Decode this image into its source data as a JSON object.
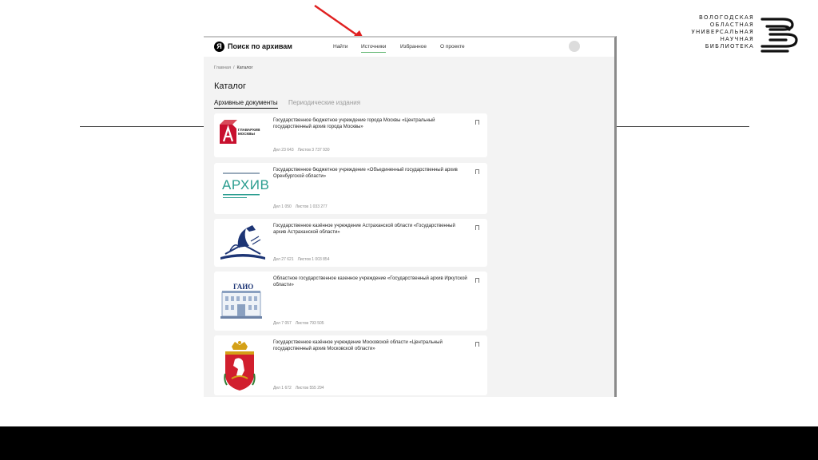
{
  "library": {
    "lines": [
      "ВОЛОГОДСКАЯ",
      "ОБЛАСТНАЯ",
      "УНИВЕРСАЛЬНАЯ",
      "НАУЧНАЯ",
      "БИБЛИОТЕКА"
    ]
  },
  "app": {
    "brand": "Поиск по архивам",
    "nav": [
      "Найти",
      "Источники",
      "Избранное",
      "О проекте"
    ],
    "active_nav": "Источники"
  },
  "breadcrumb": {
    "home": "Главная",
    "separator": "/",
    "current": "Каталог"
  },
  "page_title": "Каталог",
  "tabs": [
    "Архивные документы",
    "Периодические издания"
  ],
  "archives": [
    {
      "logo_icon": "glavarchiv-moscow-logo",
      "logo_text": "ГЛАВАРХИВ МОСКВЫ",
      "title": "Государственное бюджетное учреждение города Москвы «Центральный государственный архив города Москвы»",
      "cases": "Дел 23 643",
      "sheets": "Листов 3 737 930"
    },
    {
      "logo_icon": "orenburg-archive-logo",
      "logo_text": "АРХИВ",
      "title": "Государственное бюджетное учреждение «Объединенный государственный архив Оренбургской области»",
      "cases": "Дел 1 050",
      "sheets": "Листов 1 033 277"
    },
    {
      "logo_icon": "astrakhan-archive-logo",
      "title": "Государственное казённое учреждение Астраханской области «Государственный архив Астраханской области»",
      "cases": "Дел 27 621",
      "sheets": "Листов 1 003 854"
    },
    {
      "logo_icon": "gaio-building-logo",
      "logo_text": "ГАИО",
      "title": "Областное государственное казенное учреждение «Государственный архив Иркутской области»",
      "cases": "Дел 7 057",
      "sheets": "Листов 793 505"
    },
    {
      "logo_icon": "moscow-region-coat-of-arms",
      "title": "Государственное казённое учреждение Московской области «Центральный государственный архив Московской области»",
      "cases": "Дел 1 672",
      "sheets": "Листов 555 294"
    }
  ]
}
